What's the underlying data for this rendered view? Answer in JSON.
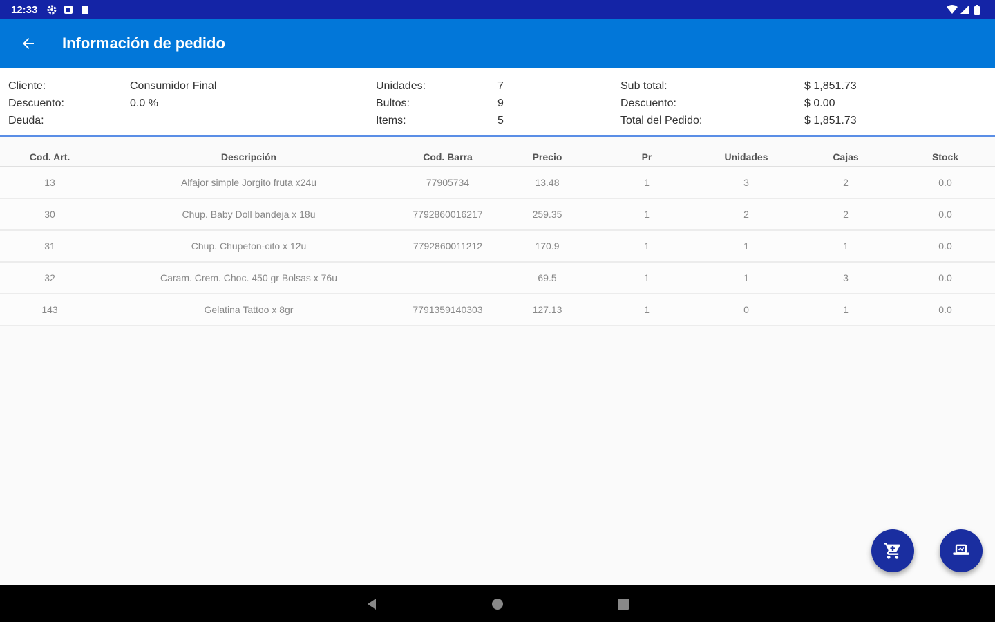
{
  "status_bar": {
    "time": "12:33",
    "icons": [
      "settings-icon",
      "notification-icon",
      "sd-card-icon",
      "wifi-icon",
      "signal-icon",
      "battery-icon"
    ]
  },
  "app_bar": {
    "title": "Información de pedido",
    "back_icon": "arrow-left-icon"
  },
  "summary": {
    "cliente_label": "Cliente:",
    "cliente_value": "Consumidor Final",
    "descuento_label": "Descuento:",
    "descuento_value": "0.0 %",
    "deuda_label": "Deuda:",
    "deuda_value": "",
    "unidades_label": "Unidades:",
    "unidades_value": "7",
    "bultos_label": "Bultos:",
    "bultos_value": "9",
    "items_label": "Items:",
    "items_value": "5",
    "subtotal_label": "Sub total:",
    "subtotal_value": "$ 1,851.73",
    "descuento2_label": "Descuento:",
    "descuento2_value": "$ 0.00",
    "total_label": "Total del Pedido:",
    "total_value": "$ 1,851.73"
  },
  "table": {
    "headers": [
      "Cod. Art.",
      "Descripción",
      "Cod. Barra",
      "Precio",
      "Pr",
      "Unidades",
      "Cajas",
      "Stock"
    ],
    "rows": [
      [
        "13",
        "Alfajor simple Jorgito fruta x24u",
        "77905734",
        "13.48",
        "1",
        "3",
        "2",
        "0.0"
      ],
      [
        "30",
        "Chup. Baby Doll bandeja x 18u",
        "7792860016217",
        "259.35",
        "1",
        "2",
        "2",
        "0.0"
      ],
      [
        "31",
        "Chup. Chupeton-cito x 12u",
        "7792860011212",
        "170.9",
        "1",
        "1",
        "1",
        "0.0"
      ],
      [
        "32",
        "Caram. Crem. Choc. 450 gr Bolsas x 76u",
        "",
        "69.5",
        "1",
        "1",
        "3",
        "0.0"
      ],
      [
        "143",
        "Gelatina Tattoo x 8gr",
        "7791359140303",
        "127.13",
        "1",
        "0",
        "1",
        "0.0"
      ]
    ]
  },
  "fabs": {
    "cart_icon": "shopping-cart-icon",
    "truck_icon": "delivery-truck-icon"
  },
  "colors": {
    "status_bar": "#1424a6",
    "app_bar": "#0277d9",
    "fab": "#1a2ea0",
    "divider": "#5a8ee6"
  }
}
